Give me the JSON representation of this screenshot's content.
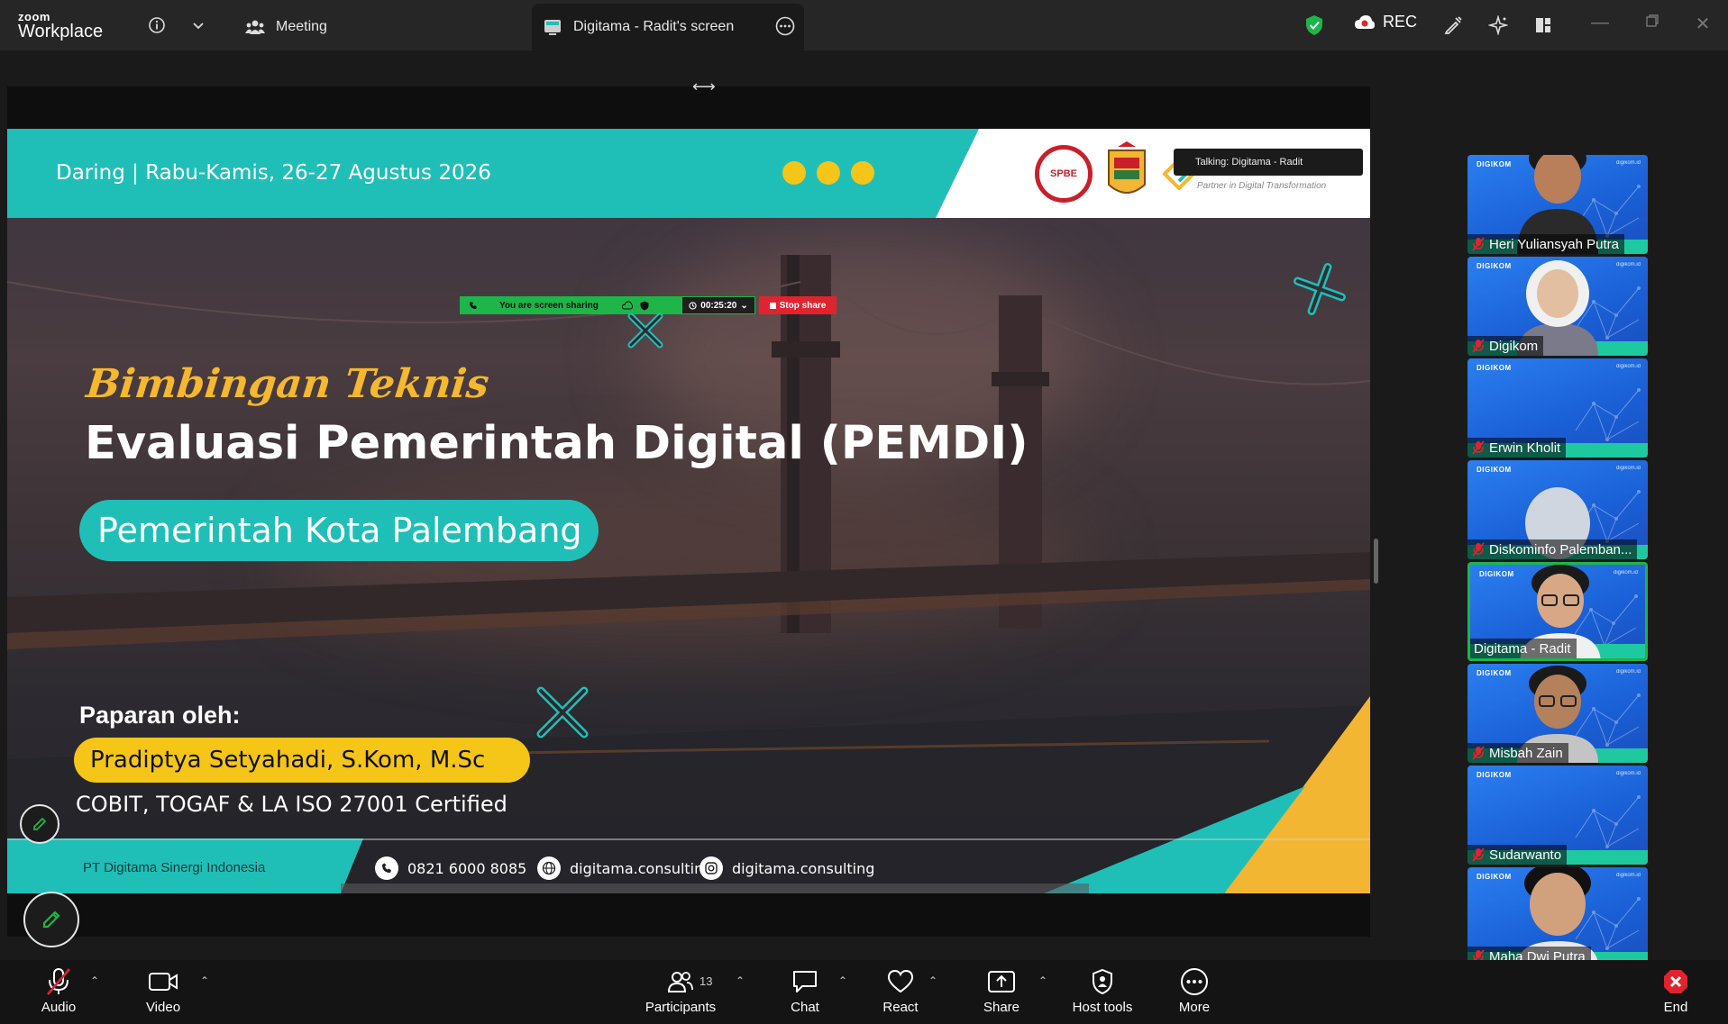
{
  "titlebar": {
    "brand_top": "zoom",
    "brand_bottom": "Workplace",
    "tab_meeting": "Meeting",
    "tab_screen": "Digitama - Radit's screen",
    "rec_label": "REC"
  },
  "slide": {
    "date_line": "Daring | Rabu-Kamis, 26-27 Agustus 2026",
    "talking": "Talking: Digitama - Radit",
    "partner": "Partner in Digital Transformation",
    "logo_text": "SPBE",
    "share_status": "You are screen sharing",
    "timer": "00:25:20",
    "stop_share": "Stop share",
    "subtitle": "Bimbingan Teknis",
    "title": "Evaluasi Pemerintah Digital (PEMDI)",
    "org": "Pemerintah Kota Palembang",
    "presented_by": "Paparan oleh:",
    "presenter": "Pradiptya Setyahadi, S.Kom, M.Sc",
    "certs": "COBIT, TOGAF & LA ISO 27001 Certified",
    "company": "PT Digitama Sinergi Indonesia",
    "phone": "0821 6000 8085",
    "website": "digitama.consulting",
    "instagram": "digitama.consulting"
  },
  "participants": [
    {
      "name": "Heri Yuliansyah Putra",
      "muted": true
    },
    {
      "name": "Digikom",
      "muted": true
    },
    {
      "name": "Erwin Kholit",
      "muted": true
    },
    {
      "name": "Diskominfo Palemban...",
      "muted": true
    },
    {
      "name": "Digitama - Radit",
      "muted": false,
      "speaking": true
    },
    {
      "name": "Misbah Zain",
      "muted": true
    },
    {
      "name": "Sudarwanto",
      "muted": true
    },
    {
      "name": "Maha Dwi Putra",
      "muted": true
    }
  ],
  "tile_brand": "DIGIKOM",
  "tile_corner": "digikom.id",
  "toolbar": {
    "audio": "Audio",
    "video": "Video",
    "participants": "Participants",
    "participants_count": "13",
    "chat": "Chat",
    "react": "React",
    "share": "Share",
    "host_tools": "Host tools",
    "more": "More",
    "end": "End"
  },
  "colors": {
    "teal": "#1fbfb8",
    "yellow": "#f5c518",
    "speaking_border": "#1eb549",
    "end_red": "#e0242f"
  }
}
